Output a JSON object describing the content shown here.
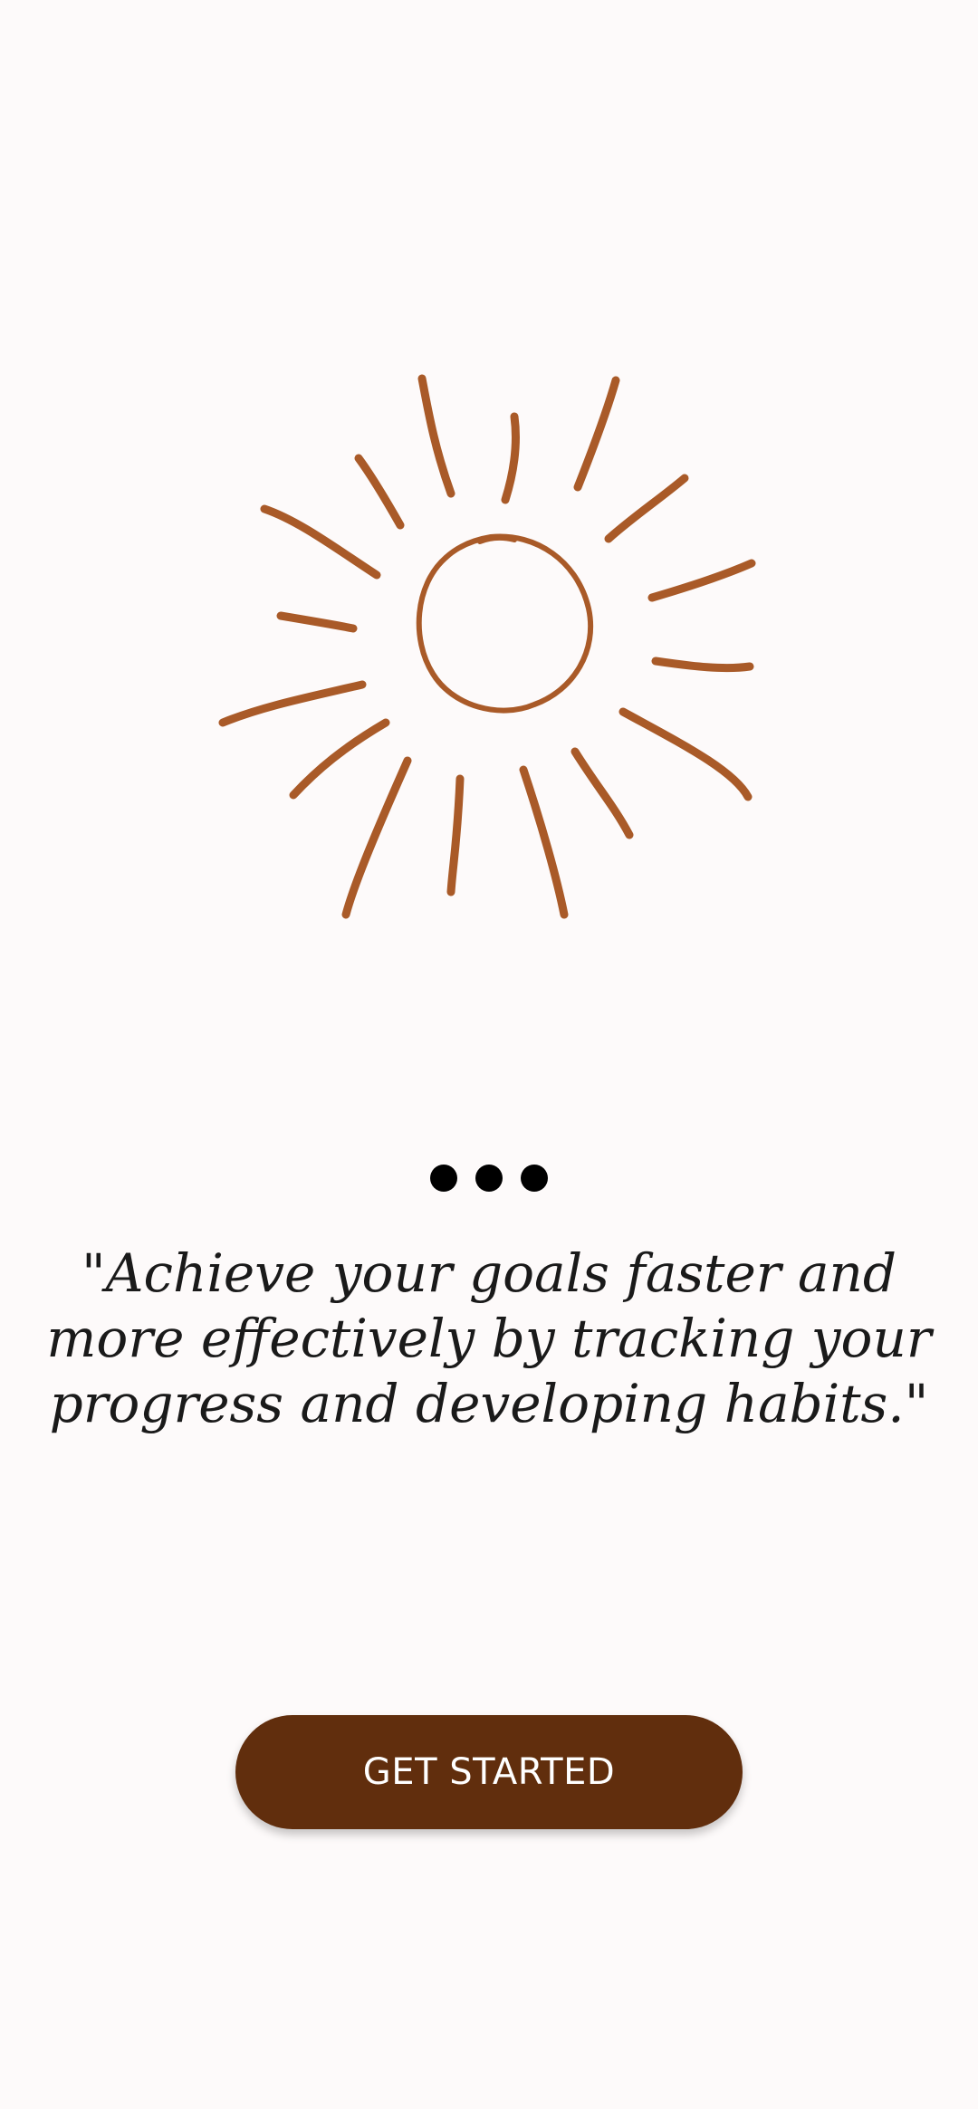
{
  "illustration": {
    "icon": "sun-icon",
    "color": "#a95a28"
  },
  "pager": {
    "count": 3,
    "active_color": "#000000"
  },
  "quote": {
    "text": "\"Achieve your goals faster and more effectively by tracking your progress and developing habits.\""
  },
  "cta": {
    "label": "GET STARTED",
    "background": "#612e0d"
  }
}
